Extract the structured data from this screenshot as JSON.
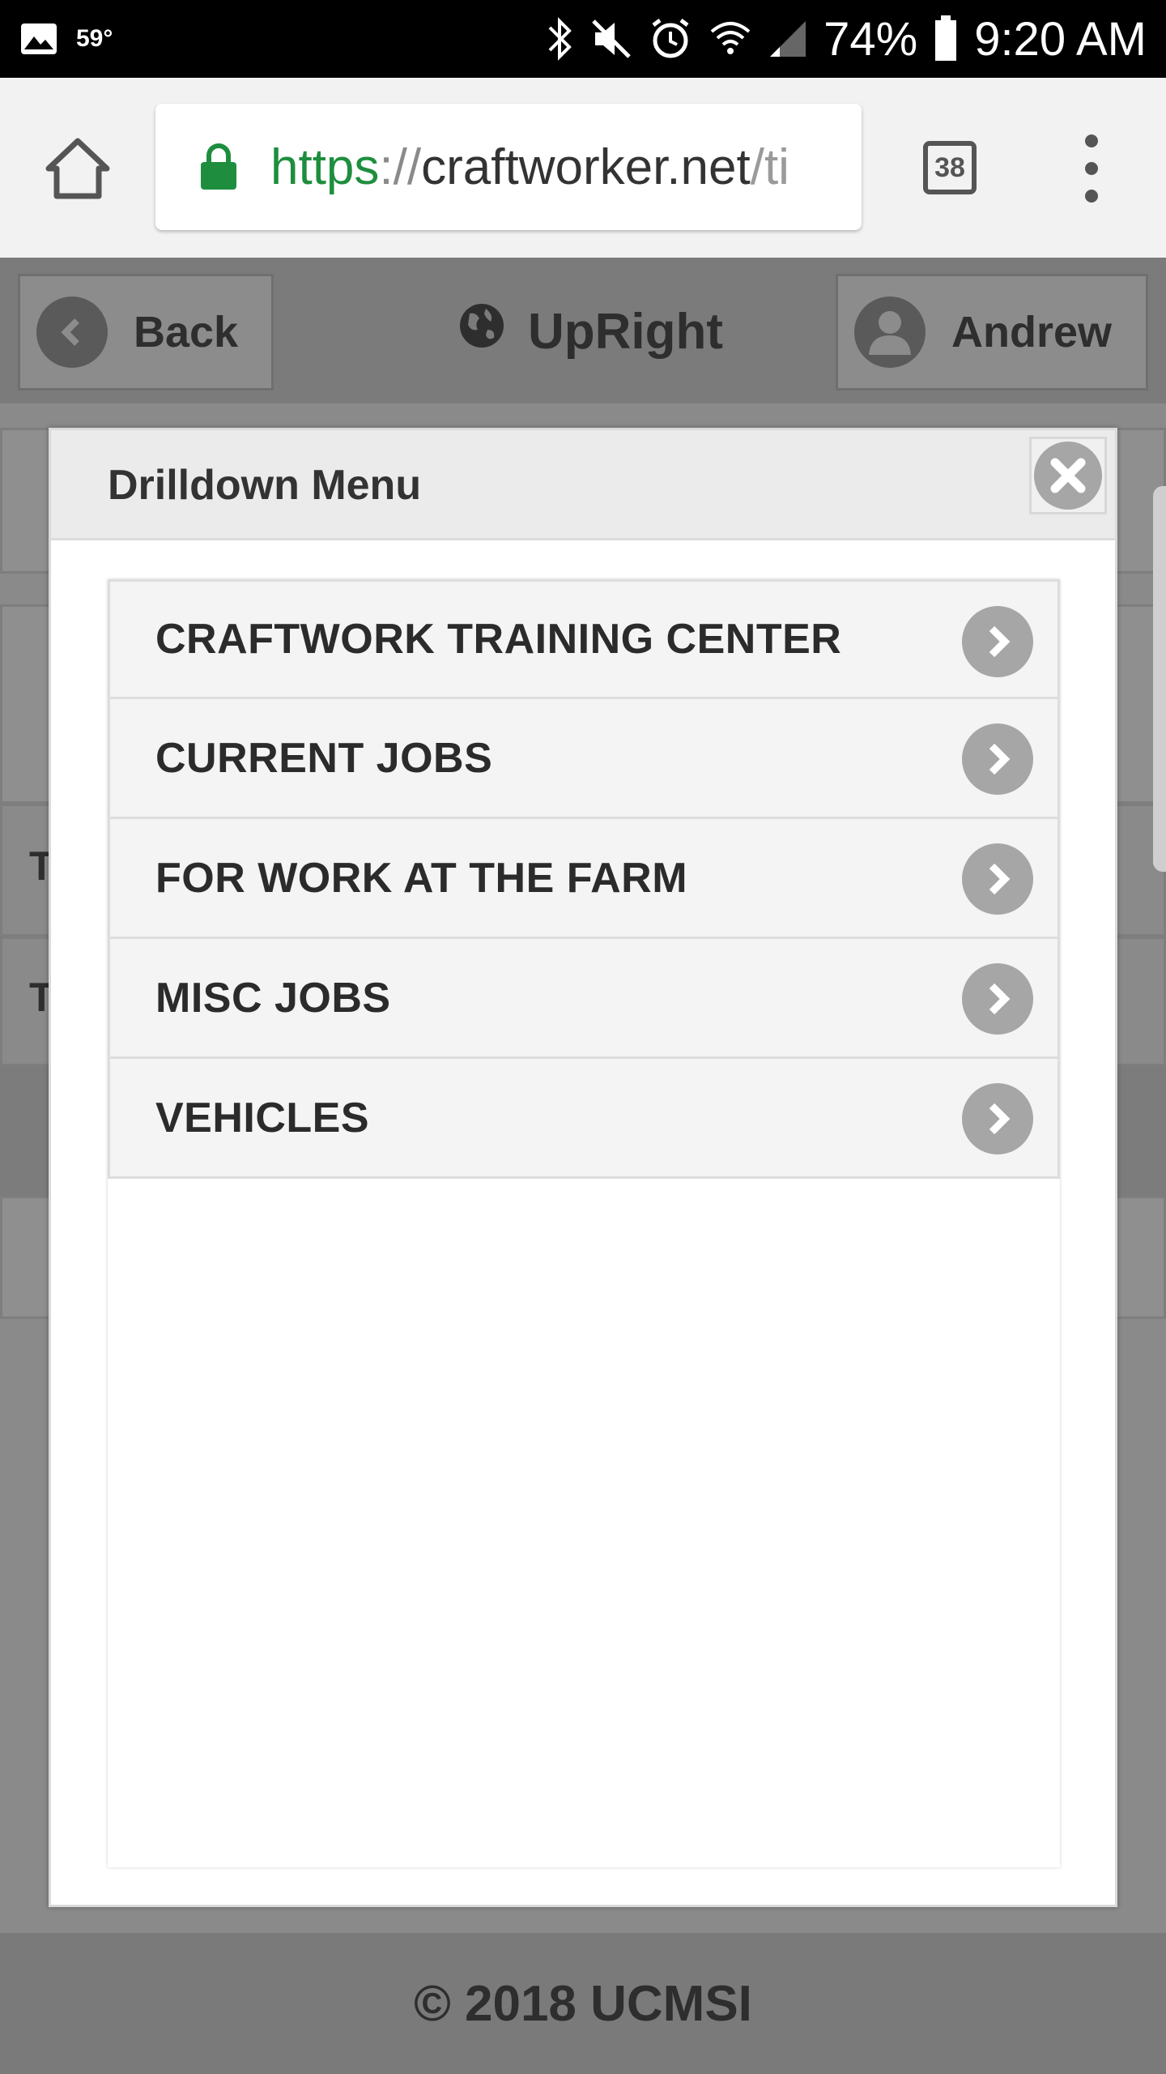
{
  "status_bar": {
    "temperature": "59°",
    "battery_percent": "74%",
    "time": "9:20 AM",
    "icons": [
      "image-icon",
      "bluetooth-icon",
      "mute-icon",
      "alarm-icon",
      "wifi-icon",
      "signal-icon",
      "battery-icon"
    ]
  },
  "browser": {
    "url_scheme": "https",
    "url_sep": "://",
    "url_host": "craftworker.net",
    "url_rest": "/ti",
    "tab_count": "38",
    "secure": true
  },
  "header": {
    "back_label": "Back",
    "app_title": "UpRight",
    "user_label": "Andrew"
  },
  "background_rows": {
    "letter_1": "T",
    "letter_2": "T"
  },
  "modal": {
    "title": "Drilldown Menu",
    "items": [
      {
        "label": "CRAFTWORK TRAINING CENTER"
      },
      {
        "label": "CURRENT JOBS"
      },
      {
        "label": "FOR WORK AT THE FARM"
      },
      {
        "label": "MISC JOBS"
      },
      {
        "label": "VEHICLES"
      }
    ]
  },
  "footer": {
    "copyright": "© 2018 UCMSI"
  },
  "colors": {
    "secure_green": "#1e8e3e",
    "overlay_gray": "#8a8a8a",
    "chevron_gray": "#a6a6a6"
  }
}
